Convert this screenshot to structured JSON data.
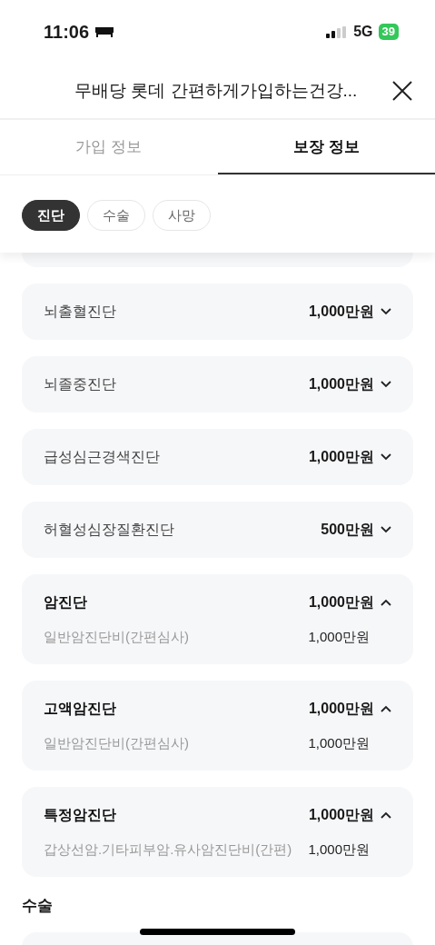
{
  "status_bar": {
    "time": "11:06",
    "network": "5G",
    "battery": "39"
  },
  "header": {
    "title": "무배당 롯데 간편하게가입하는건강..."
  },
  "tabs": [
    {
      "label": "가입 정보",
      "selected": false
    },
    {
      "label": "보장 정보",
      "selected": true
    }
  ],
  "chips": [
    {
      "label": "진단",
      "selected": true
    },
    {
      "label": "수술",
      "selected": false
    },
    {
      "label": "사망",
      "selected": false
    }
  ],
  "coverages": [
    {
      "title": "뇌출혈진단",
      "amount": "1,000만원",
      "expanded": false
    },
    {
      "title": "뇌졸중진단",
      "amount": "1,000만원",
      "expanded": false
    },
    {
      "title": "급성심근경색진단",
      "amount": "1,000만원",
      "expanded": false
    },
    {
      "title": "허혈성심장질환진단",
      "amount": "500만원",
      "expanded": false
    },
    {
      "title": "암진단",
      "amount": "1,000만원",
      "expanded": true,
      "items": [
        {
          "label": "일반암진단비(간편심사)",
          "amount": "1,000만원"
        }
      ]
    },
    {
      "title": "고액암진단",
      "amount": "1,000만원",
      "expanded": true,
      "items": [
        {
          "label": "일반암진단비(간편심사)",
          "amount": "1,000만원"
        }
      ]
    },
    {
      "title": "특정암진단",
      "amount": "1,000만원",
      "expanded": true,
      "items": [
        {
          "label": "갑상선암.기타피부암.유사암진단비(간편)",
          "amount": "1,000만원"
        }
      ]
    }
  ],
  "next_section": {
    "title": "수술"
  }
}
